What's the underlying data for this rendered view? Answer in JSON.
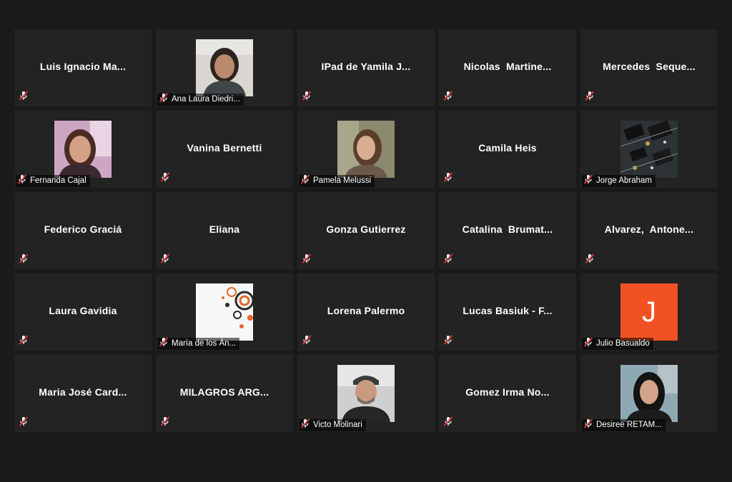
{
  "participants": [
    {
      "label": "Luis Ignacio Ma..."
    },
    {
      "label": "Ana Laura Diedri..."
    },
    {
      "label": "IPad de Yamila J..."
    },
    {
      "label": "Nicolas  Martine..."
    },
    {
      "label": "Mercedes  Seque..."
    },
    {
      "label": "Fernanda Cajal"
    },
    {
      "label": "Vanina Bernetti"
    },
    {
      "label": "Pamela Melussi"
    },
    {
      "label": "Camila Heis"
    },
    {
      "label": "Jorge Abraham"
    },
    {
      "label": "Federico Graciá"
    },
    {
      "label": "Eliana"
    },
    {
      "label": "Gonza Gutierrez"
    },
    {
      "label": "Catalina  Brumat..."
    },
    {
      "label": "Alvarez,  Antone..."
    },
    {
      "label": "Laura Gavidia"
    },
    {
      "label": "María de los Án..."
    },
    {
      "label": "Lorena Palermo"
    },
    {
      "label": "Lucas Basiuk - F..."
    },
    {
      "label": "Julio Basualdo",
      "initial": "J"
    },
    {
      "label": "Maria José Card..."
    },
    {
      "label": "MILAGROS ARG..."
    },
    {
      "label": "Victo Molinari"
    },
    {
      "label": "Gomez Irma No..."
    },
    {
      "label": "Desiree RETAM..."
    }
  ],
  "colors": {
    "background": "#1a1a1a",
    "tile": "#232323",
    "mute_icon": "#e0393e",
    "initial_avatar": "#f05223"
  }
}
